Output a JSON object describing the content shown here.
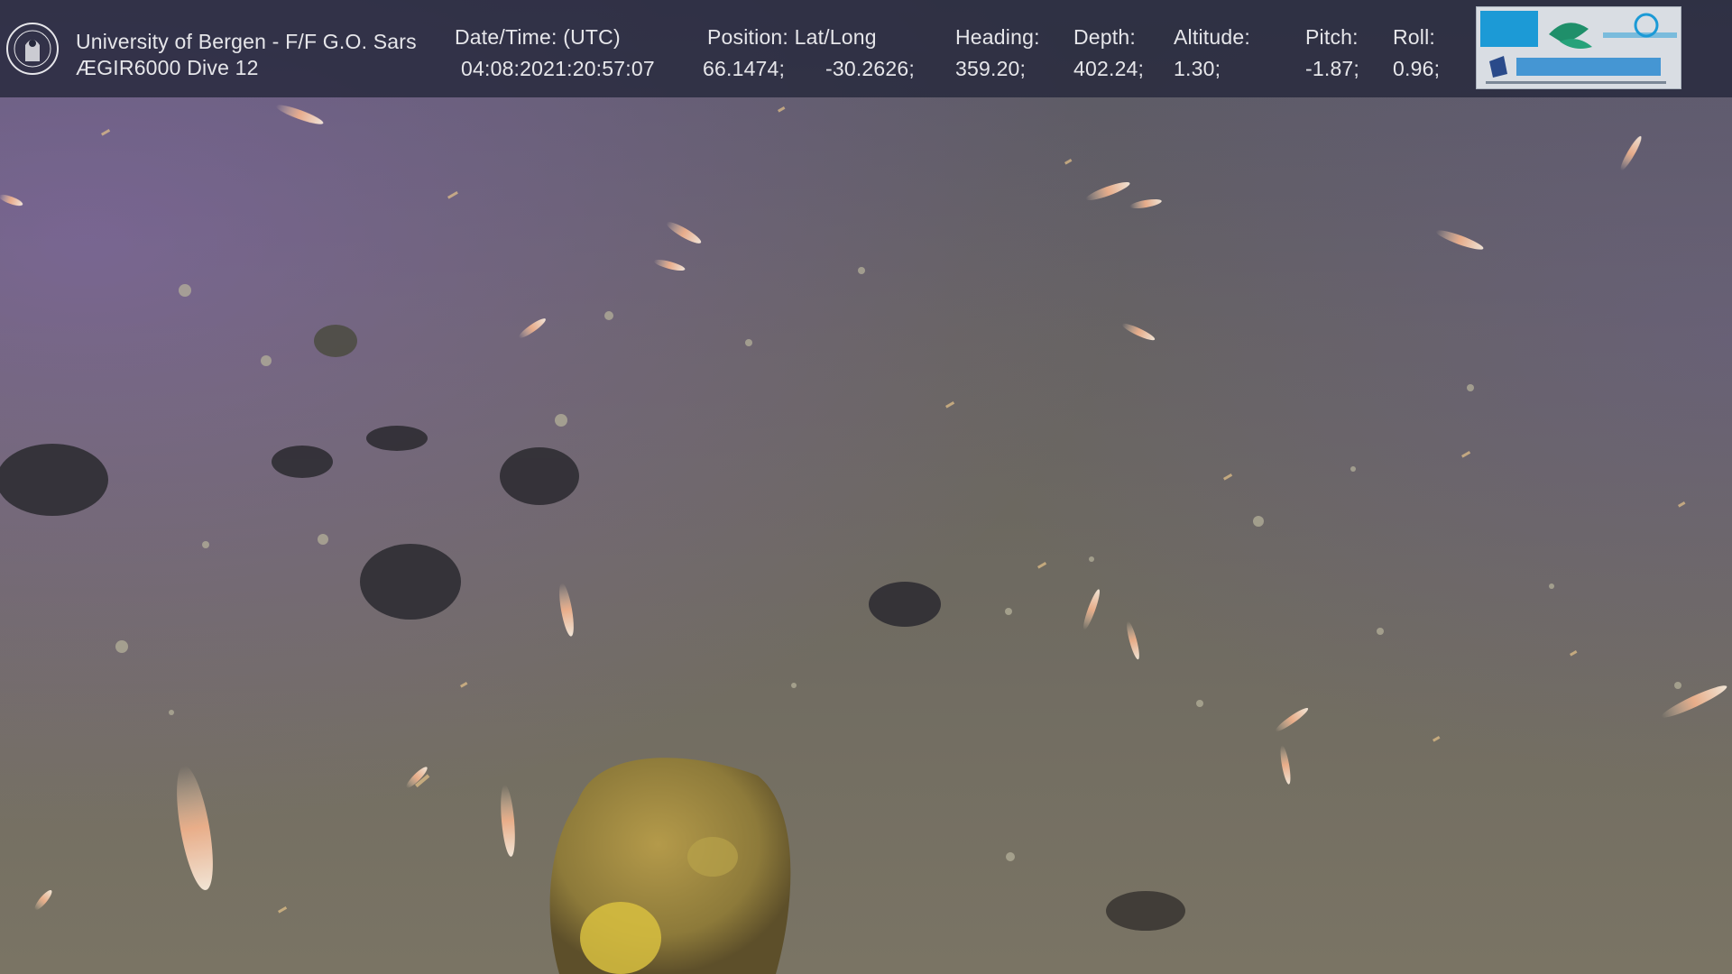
{
  "overlay": {
    "institution": "University of Bergen - F/F G.O. Sars",
    "dive": "ÆGIR6000 Dive 12",
    "datetime_label": "Date/Time: (UTC)",
    "datetime_value": "04:08:2021:20:57:07",
    "position_label": "Position: Lat/Long",
    "lat_value": "66.1474;",
    "long_value": "-30.2626;",
    "heading_label": "Heading:",
    "heading_value": "359.20;",
    "depth_label": "Depth:",
    "depth_value": "402.24;",
    "altitude_label": "Altitude:",
    "altitude_value": "1.30;",
    "pitch_label": "Pitch:",
    "pitch_value": "-1.87;",
    "roll_label": "Roll:",
    "roll_value": "0.96;"
  },
  "icons": {
    "seal": "university-seal-icon",
    "logos": "partner-logos-icon"
  },
  "colors": {
    "overlay_bg": "#26283c",
    "overlay_text": "#e6e6ea",
    "seafloor": "#6b6963",
    "water_tint": "#5a4f78",
    "shrimp": "#f2b58a",
    "rock": "#8a7a3a"
  }
}
